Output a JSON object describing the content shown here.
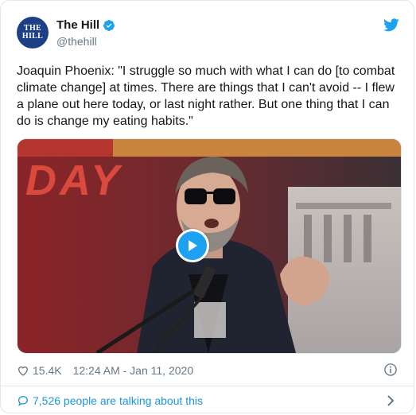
{
  "account": {
    "display_name": "The Hill",
    "handle": "@thehill",
    "avatar_text": "THE\nHILL",
    "verified_icon": "verified-badge-icon"
  },
  "tweet": {
    "text": "Joaquin Phoenix: \"I struggle so much with what I can do [to combat climate change] at times. There are things that I can't avoid -- I flew a plane out here today, or last night rather. But one thing that I can do is change my eating habits.\"",
    "banner_text": "DAY"
  },
  "meta": {
    "likes": "15.4K",
    "timestamp": "12:24 AM - Jan 11, 2020"
  },
  "footer": {
    "conversation": "7,526 people are talking about this"
  },
  "colors": {
    "accent": "#1da1f2",
    "link": "#1b95e0",
    "muted": "#657786",
    "avatar_bg": "#1d3f86"
  }
}
